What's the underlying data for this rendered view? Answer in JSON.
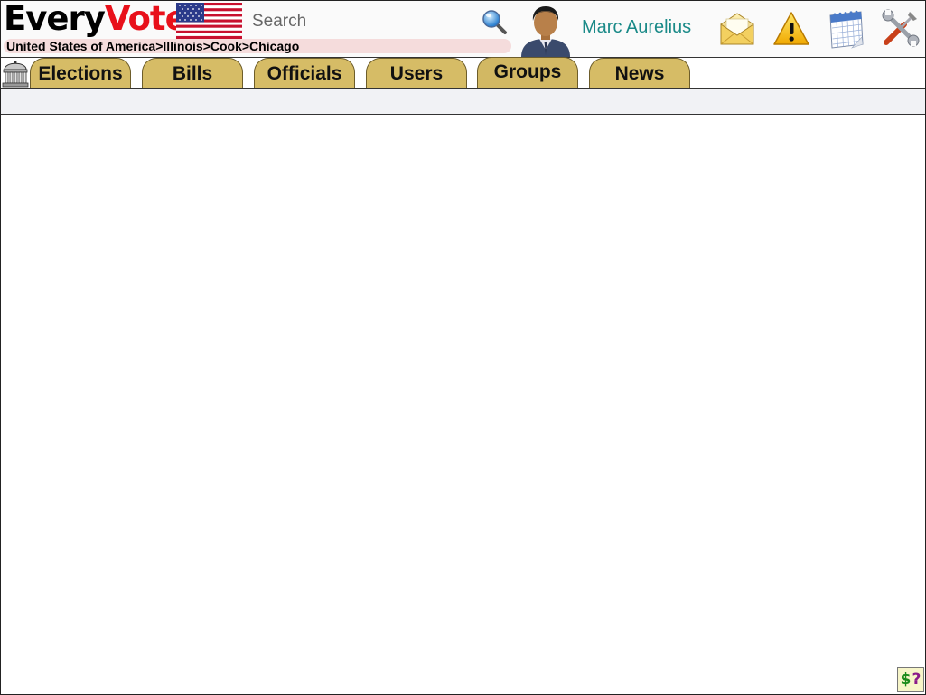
{
  "header": {
    "logo_part1": "Every",
    "logo_part2": "Vote",
    "search_placeholder": "Search",
    "breadcrumb": "United States of America>Illinois>Cook>Chicago",
    "user_name": "Marc Aurelius",
    "icons": [
      "us-flag",
      "search-icon",
      "user-avatar",
      "mail-icon",
      "alert-icon",
      "calendar-icon",
      "settings-tools-icon"
    ]
  },
  "tabs": [
    {
      "label": "Elections"
    },
    {
      "label": "Bills"
    },
    {
      "label": "Officials"
    },
    {
      "label": "Users"
    },
    {
      "label": "Groups"
    },
    {
      "label": "News"
    }
  ],
  "footer": {
    "help_dollar": "$",
    "help_question": "?"
  },
  "colors": {
    "brand_red": "#e8101a",
    "tab_gold": "#d6bc66",
    "username_teal": "#1a8a88",
    "breadcrumb_bg": "#f5dcdc"
  }
}
